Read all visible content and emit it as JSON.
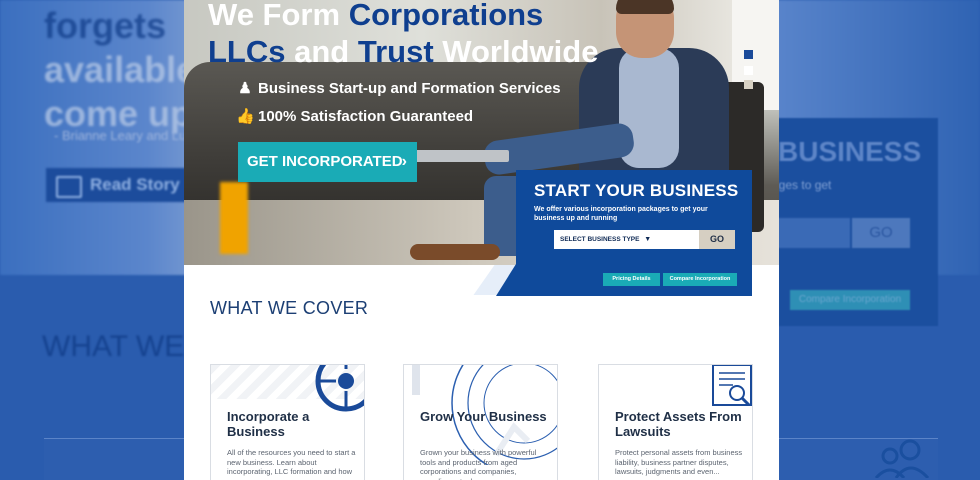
{
  "background": {
    "left_text": [
      "forgets",
      "available",
      "come up"
    ],
    "left_quote": "- Brianne Leary and Lu",
    "read_story_label": "Read Story",
    "right_title": "BUSINESS",
    "right_subtitle": "ages to get",
    "right_go": "GO",
    "right_compare": "Compare Incorporation",
    "what_we_partial": "WHAT WE C"
  },
  "hero": {
    "headline_line1_white": "We Form",
    "headline_line1_blue": "Corporations",
    "headline_line2_blue1": "LLCs",
    "headline_line2_white1": "and",
    "headline_line2_blue2": "Trust",
    "headline_line2_white2": "Worldwide",
    "features": [
      {
        "icon": "briefcase-person-icon",
        "text": "Business Start-up and Formation Services"
      },
      {
        "icon": "thumbs-up-icon",
        "text": "100% Satisfaction Guaranteed"
      }
    ],
    "cta_label": "GET INCORPORATED"
  },
  "start_box": {
    "title": "START YOUR BUSINESS",
    "subtitle": "We offer various incorporation packages to get your business up and running",
    "select_label": "SELECT BUSINESS TYPE",
    "go_label": "GO",
    "pricing_label": "Pricing Details",
    "compare_label": "Compare Incorporation"
  },
  "section_title": "WHAT WE COVER",
  "cards": [
    {
      "title": "Incorporate a Business",
      "description": "All of the resources you need to start a new business. Learn about incorporating, LLC formation and how you..."
    },
    {
      "title": "Grow Your Business",
      "description": "Grown your business with powerful tools and products from aged corporations and companies, compliance tools..."
    },
    {
      "title": "Protect Assets From Lawsuits",
      "description": "Protect personal assets from business liability, business partner disputes, lawsuits, judgments and even..."
    }
  ],
  "colors": {
    "brand_blue": "#0f4a9b",
    "accent_teal": "#1aabb6",
    "background_blue": "#2a5cae"
  }
}
